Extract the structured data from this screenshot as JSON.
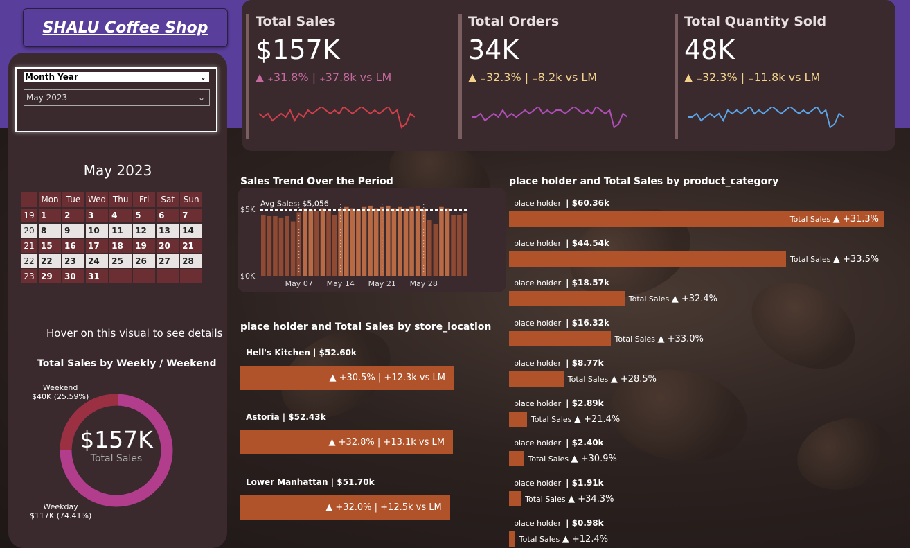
{
  "title": "SHALU Coffee Shop",
  "slicer": {
    "header": "Month Year",
    "selected": "May 2023",
    "chevron_icon": "chevron-down-icon"
  },
  "calendar": {
    "title": "May 2023",
    "days": [
      "Mon",
      "Tue",
      "Wed",
      "Thu",
      "Fri",
      "Sat",
      "Sun"
    ],
    "weeks": [
      {
        "wk": "19",
        "d": [
          "1",
          "2",
          "3",
          "4",
          "5",
          "6",
          "7"
        ]
      },
      {
        "wk": "20",
        "d": [
          "8",
          "9",
          "10",
          "11",
          "12",
          "13",
          "14"
        ]
      },
      {
        "wk": "21",
        "d": [
          "15",
          "16",
          "17",
          "18",
          "19",
          "20",
          "21"
        ]
      },
      {
        "wk": "22",
        "d": [
          "22",
          "23",
          "24",
          "25",
          "26",
          "27",
          "28"
        ]
      },
      {
        "wk": "23",
        "d": [
          "29",
          "30",
          "31",
          "",
          "",
          "",
          ""
        ]
      }
    ]
  },
  "hover_note": "Hover on this visual to see details",
  "donut": {
    "title": "Total Sales by Weekly / Weekend",
    "center_value": "$157K",
    "center_label": "Total Sales",
    "weekend_label": "Weekend",
    "weekend_value": "$40K (25.59%)",
    "weekday_label": "Weekday",
    "weekday_value": "$117K (74.41%)",
    "weekend_share": 0.2559,
    "colors": {
      "weekend": "#9b3042",
      "weekday": "#b23d8c"
    }
  },
  "kpis": [
    {
      "title": "Total Sales",
      "value": "$157K",
      "change": "▲ ₊31.8% | ₊37.8k vs LM",
      "color": "#c76a9f",
      "spark_color": "#d0404a",
      "spark": [
        6,
        5,
        6,
        4,
        5,
        6,
        5,
        7,
        4,
        6,
        5,
        7,
        6,
        7,
        8,
        7,
        6,
        7,
        6,
        8,
        7,
        6,
        7,
        8,
        7,
        6,
        7,
        6,
        7,
        8,
        6,
        7,
        2,
        3,
        6,
        5
      ]
    },
    {
      "title": "Total Orders",
      "value": "34K",
      "change": "▲ ₊32.3% | ₊8.2k vs LM",
      "color": "#f2d28a",
      "spark_color": "#b04fb8",
      "spark": [
        5,
        5,
        6,
        4,
        5,
        6,
        5,
        7,
        5,
        6,
        5,
        6,
        7,
        6,
        7,
        8,
        6,
        7,
        6,
        7,
        7,
        6,
        7,
        8,
        7,
        6,
        7,
        6,
        8,
        7,
        6,
        7,
        2,
        3,
        6,
        5
      ]
    },
    {
      "title": "Total Quantity Sold",
      "value": "48K",
      "change": "▲ ₊32.3% | ₊11.8k vs LM",
      "color": "#f2d28a",
      "spark_color": "#5ba6e8",
      "spark": [
        5,
        5,
        6,
        4,
        5,
        6,
        5,
        6,
        4,
        7,
        6,
        7,
        6,
        7,
        8,
        6,
        7,
        6,
        7,
        8,
        7,
        6,
        7,
        8,
        7,
        6,
        7,
        6,
        7,
        8,
        6,
        7,
        2,
        3,
        6,
        5
      ]
    }
  ],
  "trend": {
    "title": "Sales Trend Over the Period",
    "avg_label": "Avg Sales: $5,056",
    "y_top": "$5K",
    "y_bottom": "$0K",
    "x_ticks": [
      "May 07",
      "May 14",
      "May 21",
      "May 28"
    ],
    "chart_data": {
      "type": "bar",
      "values": [
        4.7,
        4.6,
        4.6,
        4.5,
        4.6,
        4.2,
        4.9,
        5.2,
        5.1,
        5.0,
        5.2,
        5.0,
        4.7,
        5.2,
        5.3,
        5.2,
        5.1,
        5.3,
        5.4,
        5.2,
        5.3,
        5.4,
        5.2,
        5.3,
        5.2,
        5.3,
        5.4,
        5.2,
        4.3,
        4.0,
        5.3,
        5.2,
        4.7,
        4.7,
        4.8
      ],
      "avg": 5.056,
      "ylim": [
        0,
        5.5
      ]
    }
  },
  "store": {
    "title": "place holder and Total Sales by store_location",
    "items": [
      {
        "name": "Hell's Kitchen | $52.60k",
        "change": "▲ +30.5% | +12.3k vs LM",
        "value": 52.6
      },
      {
        "name": "Astoria | $52.43k",
        "change": "▲ +32.8% | +13.1k vs LM",
        "value": 52.43
      },
      {
        "name": "Lower Manhattan | $51.70k",
        "change": "▲ +32.0% | +12.5k vs LM",
        "value": 51.7
      }
    ]
  },
  "product": {
    "title": "place holder and Total Sales by product_category",
    "items": [
      {
        "label": "place holder",
        "value_text": "| $60.36k",
        "change": "▲ +31.3%",
        "value": 60.36
      },
      {
        "label": "place holder",
        "value_text": "| $44.54k",
        "change": "▲ +33.5%",
        "value": 44.54
      },
      {
        "label": "place holder",
        "value_text": "| $18.57k",
        "change": "▲ +32.4%",
        "value": 18.57
      },
      {
        "label": "place holder",
        "value_text": "| $16.32k",
        "change": "▲ +33.0%",
        "value": 16.32
      },
      {
        "label": "place holder",
        "value_text": "| $8.77k",
        "change": "▲ +28.5%",
        "value": 8.77
      },
      {
        "label": "place holder",
        "value_text": "| $2.89k",
        "change": "▲ +21.4%",
        "value": 2.89
      },
      {
        "label": "place holder",
        "value_text": "| $2.40k",
        "change": "▲ +30.9%",
        "value": 2.4
      },
      {
        "label": "place holder",
        "value_text": "| $1.91k",
        "change": "▲ +34.3%",
        "value": 1.91
      },
      {
        "label": "place holder",
        "value_text": "| $0.98k",
        "change": "▲ +12.4%",
        "value": 0.98
      }
    ],
    "measure_label": "Total Sales"
  }
}
